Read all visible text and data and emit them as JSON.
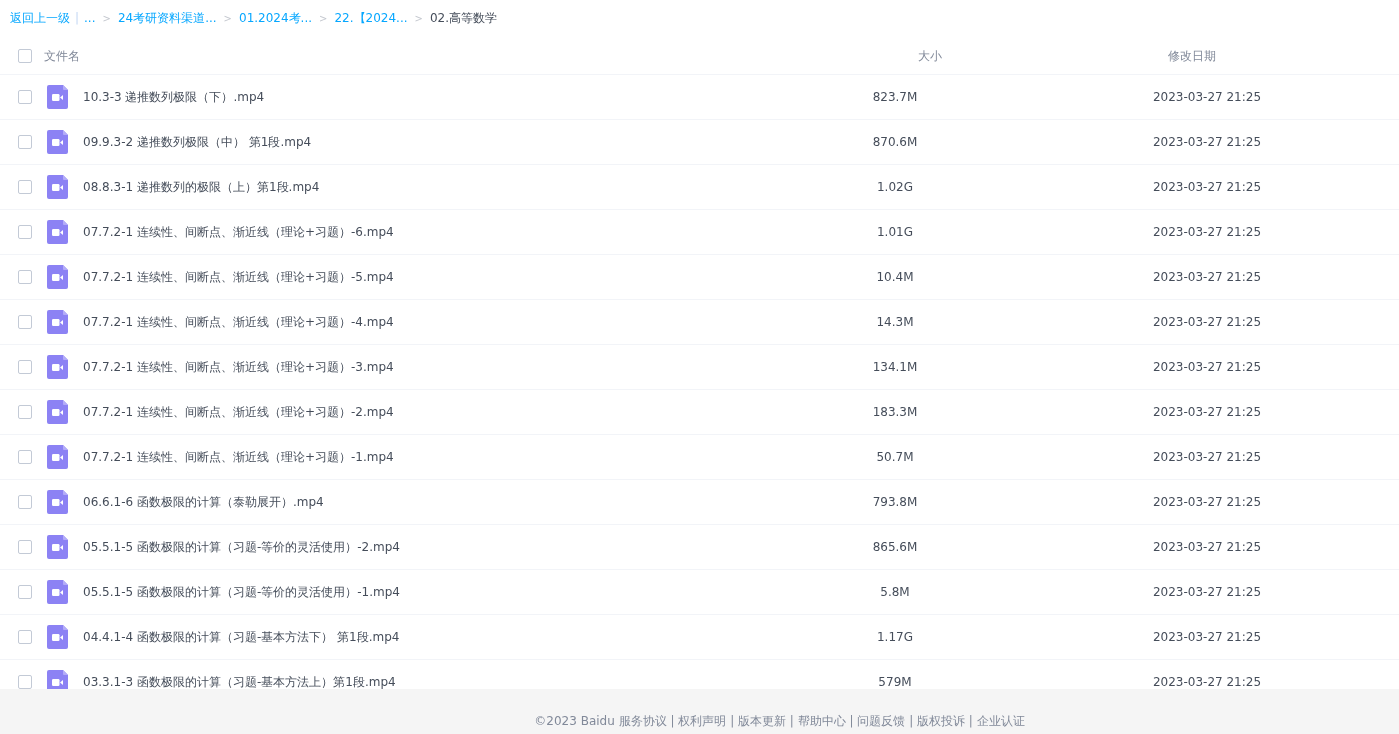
{
  "breadcrumb": [
    {
      "kind": "link",
      "text": "返回上一级"
    },
    {
      "kind": "divider",
      "text": "|"
    },
    {
      "kind": "link",
      "text": "..."
    },
    {
      "kind": "sep",
      "text": ">"
    },
    {
      "kind": "link",
      "text": "24考研资料渠道..."
    },
    {
      "kind": "sep",
      "text": ">"
    },
    {
      "kind": "link",
      "text": "01.2024考..."
    },
    {
      "kind": "sep",
      "text": ">"
    },
    {
      "kind": "link",
      "text": "22.【2024..."
    },
    {
      "kind": "sep",
      "text": ">"
    },
    {
      "kind": "current",
      "text": "02.高等数学"
    }
  ],
  "table": {
    "select_all": {
      "checked": false
    },
    "columns": [
      "文件名",
      "大小",
      "修改日期"
    ],
    "rows": [
      {
        "selected": false,
        "name": "10.3-3 递推数列极限（下）.mp4",
        "size": "823.7M",
        "date": "2023-03-27 21:25"
      },
      {
        "selected": false,
        "name": "09.9.3-2 递推数列极限（中） 第1段.mp4",
        "size": "870.6M",
        "date": "2023-03-27 21:25"
      },
      {
        "selected": false,
        "name": "08.8.3-1 递推数列的极限（上）第1段.mp4",
        "size": "1.02G",
        "date": "2023-03-27 21:25"
      },
      {
        "selected": false,
        "name": "07.7.2-1 连续性、间断点、渐近线（理论+习题）-6.mp4",
        "size": "1.01G",
        "date": "2023-03-27 21:25"
      },
      {
        "selected": false,
        "name": "07.7.2-1 连续性、间断点、渐近线（理论+习题）-5.mp4",
        "size": "10.4M",
        "date": "2023-03-27 21:25"
      },
      {
        "selected": false,
        "name": "07.7.2-1 连续性、间断点、渐近线（理论+习题）-4.mp4",
        "size": "14.3M",
        "date": "2023-03-27 21:25"
      },
      {
        "selected": false,
        "name": "07.7.2-1 连续性、间断点、渐近线（理论+习题）-3.mp4",
        "size": "134.1M",
        "date": "2023-03-27 21:25"
      },
      {
        "selected": false,
        "name": "07.7.2-1 连续性、间断点、渐近线（理论+习题）-2.mp4",
        "size": "183.3M",
        "date": "2023-03-27 21:25"
      },
      {
        "selected": false,
        "name": "07.7.2-1 连续性、间断点、渐近线（理论+习题）-1.mp4",
        "size": "50.7M",
        "date": "2023-03-27 21:25"
      },
      {
        "selected": false,
        "name": "06.6.1-6 函数极限的计算（泰勒展开）.mp4",
        "size": "793.8M",
        "date": "2023-03-27 21:25"
      },
      {
        "selected": false,
        "name": "05.5.1-5 函数极限的计算（习题-等价的灵活使用）-2.mp4",
        "size": "865.6M",
        "date": "2023-03-27 21:25"
      },
      {
        "selected": false,
        "name": "05.5.1-5 函数极限的计算（习题-等价的灵活使用）-1.mp4",
        "size": "5.8M",
        "date": "2023-03-27 21:25"
      },
      {
        "selected": false,
        "name": "04.4.1-4 函数极限的计算（习题-基本方法下） 第1段.mp4",
        "size": "1.17G",
        "date": "2023-03-27 21:25"
      },
      {
        "selected": false,
        "name": "03.3.1-3 函数极限的计算（习题-基本方法上）第1段.mp4",
        "size": "579M",
        "date": "2023-03-27 21:25"
      }
    ]
  },
  "footer": "©2023 Baidu 服务协议 | 权利声明 | 版本更新 | 帮助中心 | 问题反馈 | 版权投诉 | 企业认证"
}
